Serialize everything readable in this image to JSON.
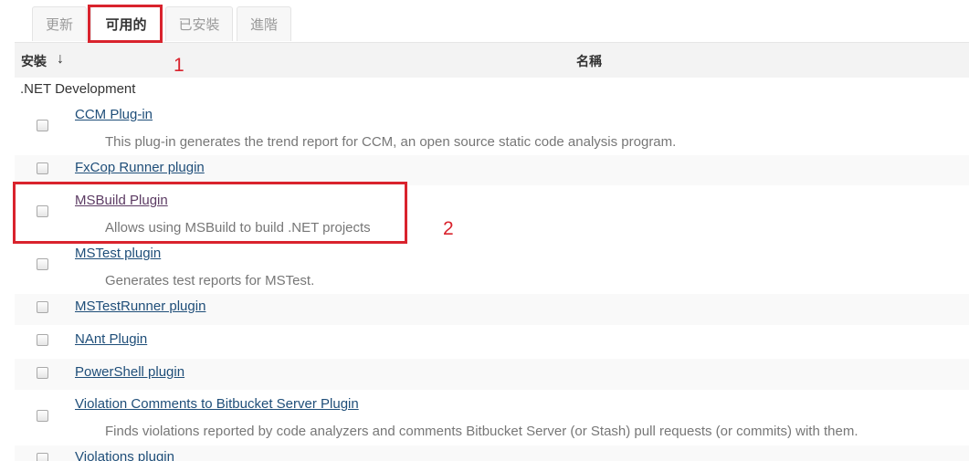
{
  "tabs": [
    {
      "label": "更新"
    },
    {
      "label": "可用的"
    },
    {
      "label": "已安裝"
    },
    {
      "label": "進階"
    }
  ],
  "table": {
    "col_install": "安裝",
    "sort_arrow": "↓",
    "col_name": "名稱",
    "category": ".NET Development",
    "plugins": [
      {
        "name": "CCM Plug-in",
        "description": "This plug-in generates the trend report for CCM, an open source static code analysis program."
      },
      {
        "name": "FxCop Runner plugin",
        "description": ""
      },
      {
        "name": "MSBuild Plugin",
        "description": "Allows using MSBuild to build .NET projects"
      },
      {
        "name": "MSTest plugin",
        "description": "Generates test reports for MSTest."
      },
      {
        "name": "MSTestRunner plugin",
        "description": ""
      },
      {
        "name": "NAnt Plugin",
        "description": ""
      },
      {
        "name": "PowerShell plugin",
        "description": ""
      },
      {
        "name": "Violation Comments to Bitbucket Server Plugin",
        "description": "Finds violations reported by code analyzers and comments Bitbucket Server (or Stash) pull requests (or commits) with them."
      },
      {
        "name": "Violations plugin",
        "description": ""
      }
    ]
  },
  "annotations": {
    "label_1": "1",
    "label_2": "2",
    "color": "#d9232d"
  },
  "colors": {
    "link": "#1f4e79",
    "visited_link": "#5c3b63",
    "description": "#777777",
    "header_bg": "#f3f3f3"
  }
}
